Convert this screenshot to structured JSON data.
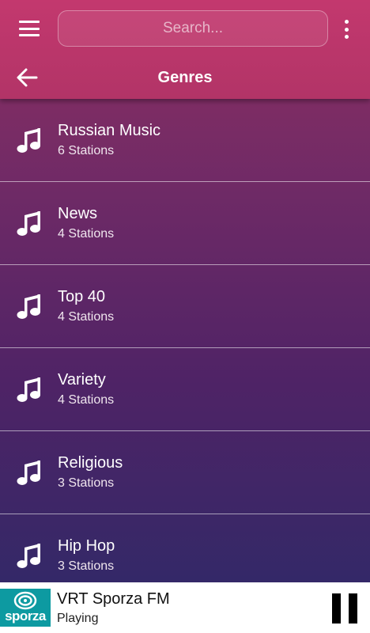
{
  "header": {
    "search_placeholder": "Search...",
    "title": "Genres"
  },
  "genres": [
    {
      "name": "Russian Music",
      "count": "6 Stations"
    },
    {
      "name": "News",
      "count": "4 Stations"
    },
    {
      "name": "Top 40",
      "count": "4 Stations"
    },
    {
      "name": "Variety",
      "count": "4 Stations"
    },
    {
      "name": "Religious",
      "count": "3 Stations"
    },
    {
      "name": "Hip Hop",
      "count": "3 Stations"
    }
  ],
  "player": {
    "logo_text": "sporza",
    "station_name": "VRT Sporza FM",
    "status": "Playing"
  },
  "icons": {
    "menu": "hamburger-icon",
    "more": "kebab-icon",
    "back": "arrow-left-icon",
    "genre": "music-note-icon",
    "playback": "pause-icon"
  },
  "colors": {
    "header": "#c3386e",
    "background_top": "#8e3062",
    "background_bottom": "#2d2a68",
    "logo_teal": "#0d9aa1"
  }
}
